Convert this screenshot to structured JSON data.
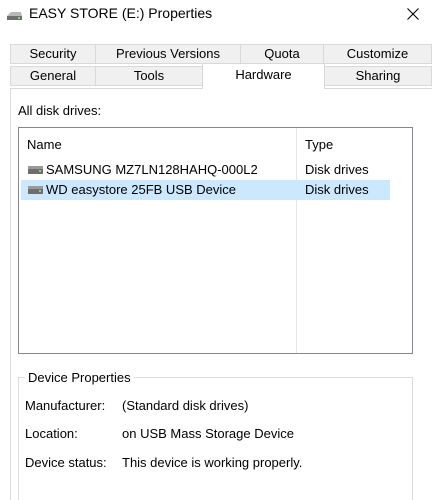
{
  "window": {
    "title": "EASY STORE  (E:) Properties",
    "close_glyph": "✕"
  },
  "tabs": {
    "row_back": [
      {
        "label": "Security"
      },
      {
        "label": "Previous Versions"
      },
      {
        "label": "Quota"
      },
      {
        "label": "Customize"
      }
    ],
    "row_front": [
      {
        "label": "General"
      },
      {
        "label": "Tools"
      },
      {
        "label": "Hardware",
        "active": true
      },
      {
        "label": "Sharing"
      }
    ]
  },
  "hardware": {
    "section_label": "All disk drives:",
    "columns": {
      "name": "Name",
      "type": "Type"
    },
    "drives": [
      {
        "name": "SAMSUNG MZ7LN128HAHQ-000L2",
        "type": "Disk drives",
        "icon": "disk-drive-icon",
        "selected": false
      },
      {
        "name": "WD easystore 25FB USB Device",
        "type": "Disk drives",
        "icon": "disk-drive-icon",
        "selected": true
      }
    ],
    "device_properties": {
      "title": "Device Properties",
      "rows": [
        {
          "label": "Manufacturer:",
          "value": "(Standard disk drives)"
        },
        {
          "label": "Location:",
          "value": "on USB Mass Storage Device"
        },
        {
          "label": "Device status:",
          "value": "This device is working properly."
        }
      ]
    }
  },
  "colors": {
    "selection": "#cce8ff",
    "tab_inactive": "#f0f0f0",
    "border": "#d9d9d9"
  }
}
